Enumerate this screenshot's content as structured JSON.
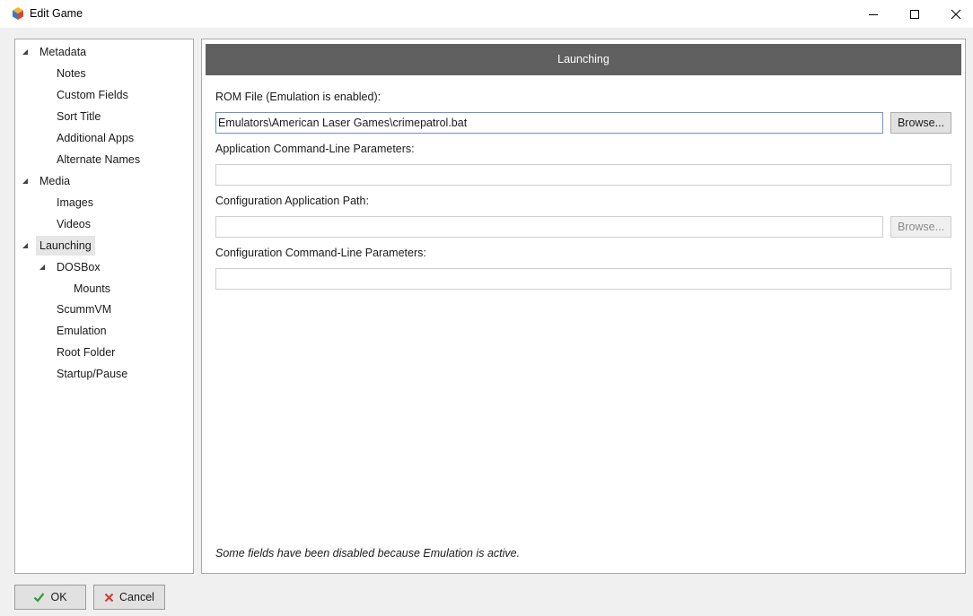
{
  "window": {
    "title": "Edit Game",
    "icon": "launchbox-cube-icon"
  },
  "tree": {
    "items": [
      {
        "label": "Metadata",
        "expanded": true
      },
      {
        "label": "Notes"
      },
      {
        "label": "Custom Fields"
      },
      {
        "label": "Sort Title"
      },
      {
        "label": "Additional Apps"
      },
      {
        "label": "Alternate Names"
      },
      {
        "label": "Media",
        "expanded": true
      },
      {
        "label": "Images"
      },
      {
        "label": "Videos"
      },
      {
        "label": "Launching",
        "expanded": true,
        "selected": true
      },
      {
        "label": "DOSBox",
        "expanded": true
      },
      {
        "label": "Mounts"
      },
      {
        "label": "ScummVM"
      },
      {
        "label": "Emulation"
      },
      {
        "label": "Root Folder"
      },
      {
        "label": "Startup/Pause"
      }
    ]
  },
  "panel": {
    "header": "Launching",
    "rom_label": "ROM File (Emulation is enabled):",
    "rom_value": "Emulators\\American Laser Games\\crimepatrol.bat",
    "browse_label": "Browse...",
    "app_params_label": "Application Command-Line Parameters:",
    "app_params_value": "",
    "config_path_label": "Configuration Application Path:",
    "config_path_value": "",
    "config_browse_label": "Browse...",
    "config_params_label": "Configuration Command-Line Parameters:",
    "config_params_value": "",
    "note": "Some fields have been disabled because Emulation is active."
  },
  "footer": {
    "ok_label": "OK",
    "cancel_label": "Cancel"
  },
  "colors": {
    "header_bg": "#606060",
    "ok_icon": "#2e9b2e",
    "cancel_icon": "#d23a3a"
  }
}
